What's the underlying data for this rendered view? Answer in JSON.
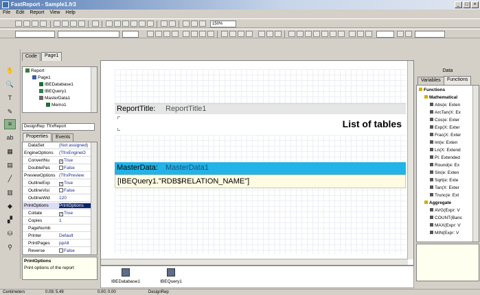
{
  "window": {
    "title": "FastReport - Sample1.fr3",
    "min": "_",
    "max": "□",
    "close": "×"
  },
  "menu": [
    "File",
    "Edit",
    "Report",
    "View",
    "Help"
  ],
  "toolbar": {
    "zoom": "150%"
  },
  "tabs": {
    "code": "Code",
    "page": "Page1"
  },
  "report_tree": [
    {
      "label": "Report",
      "indent": 0,
      "icon": "report-icon"
    },
    {
      "label": "Page1",
      "indent": 1,
      "icon": "page-icon"
    },
    {
      "label": "IBEDatabase1",
      "indent": 2,
      "icon": "database-icon"
    },
    {
      "label": "IBEQuery1",
      "indent": 2,
      "icon": "query-icon"
    },
    {
      "label": "MasterData1",
      "indent": 2,
      "icon": "band-icon"
    },
    {
      "label": "Memo1",
      "indent": 3,
      "icon": "memo-icon"
    }
  ],
  "object_combo": "DesignRep: TfrxReport",
  "inspector_tabs": {
    "properties": "Properties",
    "events": "Events"
  },
  "properties": [
    {
      "name": "DataSet",
      "value": "(Not assigned)",
      "check": ""
    },
    {
      "name": "EngineOptions",
      "value": "(TfrxEngineO",
      "check": "",
      "group": true
    },
    {
      "name": "ConvertNu",
      "value": "True",
      "check": "✓"
    },
    {
      "name": "DoublePas",
      "value": "False",
      "check": " "
    },
    {
      "name": "PreviewOptions",
      "value": "(TfrxPreview",
      "check": "",
      "group": true
    },
    {
      "name": "OutlineExp",
      "value": "True",
      "check": "✓"
    },
    {
      "name": "OutlineVisi",
      "value": "False",
      "check": " "
    },
    {
      "name": "OutlineWid",
      "value": "120",
      "check": ""
    },
    {
      "name": "PrintOptions",
      "value": "PrintOptions",
      "check": "",
      "group": true,
      "selected": true
    },
    {
      "name": "Collate",
      "value": "True",
      "check": "✓"
    },
    {
      "name": "Copies",
      "value": "1",
      "check": ""
    },
    {
      "name": "PageNumb",
      "value": "",
      "check": ""
    },
    {
      "name": "Printer",
      "value": "Default",
      "check": ""
    },
    {
      "name": "PrintPages",
      "value": "ppAll",
      "check": ""
    },
    {
      "name": "Reverse",
      "value": "False",
      "check": " "
    }
  ],
  "help": {
    "title": "PrintOptions",
    "text": "Print options of the report"
  },
  "design": {
    "band1_label": "ReportTitle:",
    "band1_name": "ReportTitle1",
    "title_text": "List of tables",
    "band2_label": "MasterData:",
    "band2_name": "MasterData1",
    "memo_text": "[IBEQuery1.\"RDB$RELATION_NAME\"]"
  },
  "components": [
    {
      "label": "IBEDatabase1",
      "icon": "database-icon"
    },
    {
      "label": "IBEQuery1",
      "icon": "query-icon"
    }
  ],
  "right_panel": {
    "header": "Data",
    "tabs": {
      "variables": "Variables",
      "functions": "Functions"
    },
    "functions_root": "Functions",
    "group1": "Mathematical",
    "group1_items": [
      "Abs(e: Exten",
      "ArcTan(X: Ex",
      "Cos(e: Exter",
      "Exp(X: Exter",
      "Frac(X: Exter",
      "Int(e: Exten",
      "Ln(X: Extend",
      "Pi: Extended",
      "Round(e: Ex",
      "Sin(e: Exten",
      "Sqrt(e: Exte",
      "Tan(X: Exter",
      "Trunc(e: Ext"
    ],
    "group2": "Aggregate",
    "group2_items": [
      "AVG(Expr: V",
      "COUNT(Banc",
      "MAX(Expr: V",
      "MIN(Expr: V"
    ]
  },
  "status": {
    "units": "Centimeters",
    "pos1": "0.09; 5.49",
    "pos2": "0.00; 0.00",
    "name": "DesignRep"
  },
  "colors": {
    "band_title": "#e6e6e6",
    "band_master": "#22b3e8",
    "memo_bg": "#fffbe3",
    "titlebar": "#5a7fb6",
    "active_tool": "#8db38d"
  }
}
